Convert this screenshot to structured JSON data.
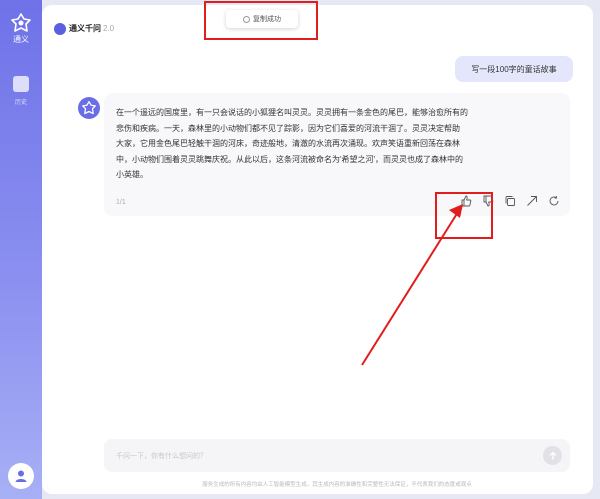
{
  "sidebar": {
    "logo_text": "通义",
    "items": [
      {
        "label": "历史"
      }
    ]
  },
  "header": {
    "title": "通义千问",
    "version": "2.0"
  },
  "toast": {
    "text": "复制成功"
  },
  "chat": {
    "user_message": "写一段100字的童话故事",
    "answer_lines": [
      "在一个遥远的国度里，有一只会说话的小狐狸名叫灵灵。灵灵拥有一条金色的尾巴，能够治愈所有的",
      "悲伤和疾病。一天，森林里的小动物们都不见了踪影，因为它们喜爱的河流干涸了。灵灵决定帮助",
      "大家，它用金色尾巴轻触干涸的河床，奇迹般地，清澈的水流再次涌现。欢声笑语重新回荡在森林",
      "中，小动物们围着灵灵跳舞庆祝。从此以后，这条河流被命名为'希望之河'，而灵灵也成了森林中的",
      "小英雄。"
    ],
    "page_indicator": "1/1",
    "actions": [
      "thumbs-up",
      "thumbs-down",
      "copy",
      "share",
      "regenerate"
    ]
  },
  "input": {
    "placeholder": "千问一下，你有什么想问的？"
  },
  "disclaimer": "服务生成的所有内容均由人工智能模型生成，其生成内容的准确性和完整性无法保证，不代表我们的态度或观点",
  "colors": {
    "accent": "#6a6ee6",
    "highlight": "#e11d1d",
    "user_bubble": "#e4e6fb"
  }
}
